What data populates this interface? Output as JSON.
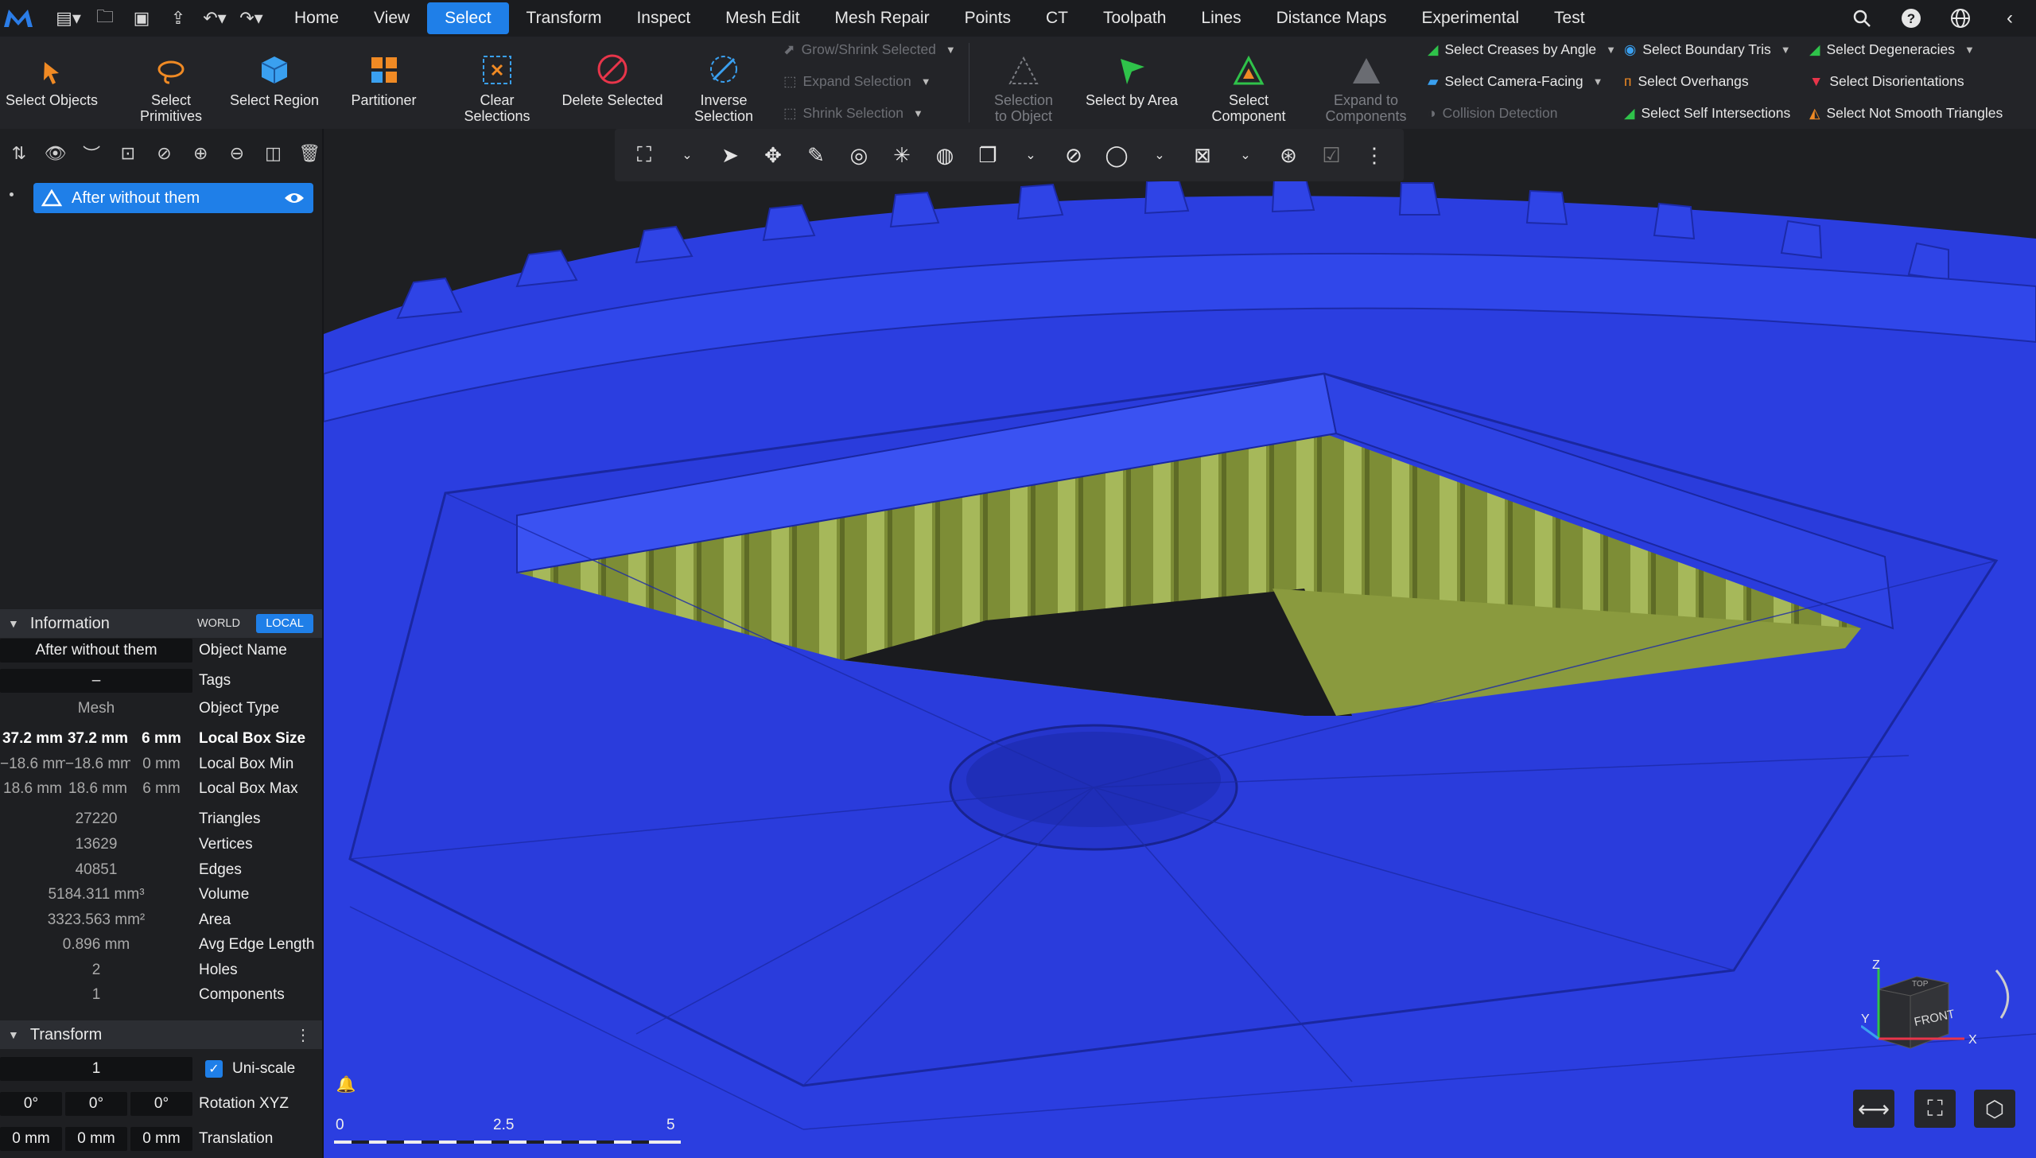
{
  "menubar": {
    "tabs": [
      "Home",
      "View",
      "Select",
      "Transform",
      "Inspect",
      "Mesh Edit",
      "Mesh Repair",
      "Points",
      "CT",
      "Toolpath",
      "Lines",
      "Distance Maps",
      "Experimental",
      "Test"
    ],
    "active_tab": "Select"
  },
  "ribbon": {
    "select_objects": "Select Objects",
    "select_primitives": "Select\nPrimitives",
    "select_region": "Select Region",
    "partitioner": "Partitioner",
    "clear_selections": "Clear\nSelections",
    "delete_selected": "Delete Selected",
    "inverse_selection": "Inverse\nSelection",
    "grow_shrink": "Grow/Shrink Selected",
    "expand_selection": "Expand Selection",
    "shrink_selection": "Shrink Selection",
    "selection_to_object": "Selection\nto Object",
    "select_by_area": "Select by Area",
    "select_component": "Select\nComponent",
    "expand_to_components": "Expand to\nComponents",
    "select_creases": "Select Creases by Angle",
    "select_camera_facing": "Select Camera-Facing",
    "collision_detection": "Collision Detection",
    "select_boundary_tris": "Select Boundary Tris",
    "select_overhangs": "Select Overhangs",
    "select_self_intersections": "Select Self Intersections",
    "select_degeneracies": "Select Degeneracies",
    "select_disorientations": "Select Disorientations",
    "select_not_smooth": "Select Not Smooth Triangles"
  },
  "scene": {
    "item_name": "After without them"
  },
  "information": {
    "header": "Information",
    "world": "WORLD",
    "local": "LOCAL",
    "object_name_value": "After without them",
    "object_name_label": "Object Name",
    "tags_value": "–",
    "tags_label": "Tags",
    "object_type_value": "Mesh",
    "object_type_label": "Object Type",
    "box_size": [
      "37.2 mm",
      "37.2 mm",
      "6 mm"
    ],
    "box_size_label": "Local Box Size",
    "box_min": [
      "−18.6 mm",
      "−18.6 mm",
      "0 mm"
    ],
    "box_min_label": "Local Box Min",
    "box_max": [
      "18.6 mm",
      "18.6 mm",
      "6 mm"
    ],
    "box_max_label": "Local Box Max",
    "triangles": "27220",
    "triangles_label": "Triangles",
    "vertices": "13629",
    "vertices_label": "Vertices",
    "edges": "40851",
    "edges_label": "Edges",
    "volume": "5184.311 mm³",
    "volume_label": "Volume",
    "area": "3323.563 mm²",
    "area_label": "Area",
    "avg_edge": "0.896 mm",
    "avg_edge_label": "Avg Edge Length",
    "holes": "2",
    "holes_label": "Holes",
    "components": "1",
    "components_label": "Components"
  },
  "transform": {
    "header": "Transform",
    "scale_value": "1",
    "uniscale_label": "Uni-scale",
    "rotation": [
      "0°",
      "0°",
      "0°"
    ],
    "rotation_label": "Rotation XYZ",
    "translation": [
      "0 mm",
      "0 mm",
      "0 mm"
    ],
    "translation_label": "Translation"
  },
  "scalebar": {
    "ticks": [
      "0",
      "2.5",
      "5"
    ]
  },
  "navcube": {
    "front": "FRONT",
    "top": "TOP",
    "x": "X",
    "y": "Y",
    "z": "Z"
  },
  "colors": {
    "accent": "#1f7fe8",
    "mesh_blue": "#2a3dde",
    "mesh_green": "#8a9a3e",
    "background": "#1e1f22"
  }
}
